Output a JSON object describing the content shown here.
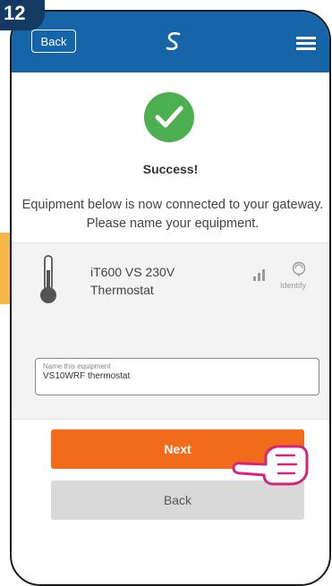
{
  "step_badge": "12",
  "header": {
    "back_label": "Back",
    "logo_icon": "salus-s-logo-icon",
    "menu_icon": "hamburger-menu-icon",
    "color": "#1565a8"
  },
  "status": {
    "icon": "checkmark-icon",
    "title": "Success!",
    "message": "Equipment below is now connected to your gateway. Please name your equipment."
  },
  "device": {
    "icon": "thermometer-icon",
    "name": "iT600 VS 230V Thermostat",
    "signal_icon": "signal-strength-icon",
    "identify_icon": "identify-icon",
    "identify_label": "Identify",
    "name_field": {
      "label": "Name this equipment",
      "value": "VS10WRF thermostat"
    }
  },
  "actions": {
    "next_label": "Next",
    "back_label": "Back",
    "next_color": "#f26b1a"
  },
  "hand_pointer_icon": "pointing-hand-icon"
}
